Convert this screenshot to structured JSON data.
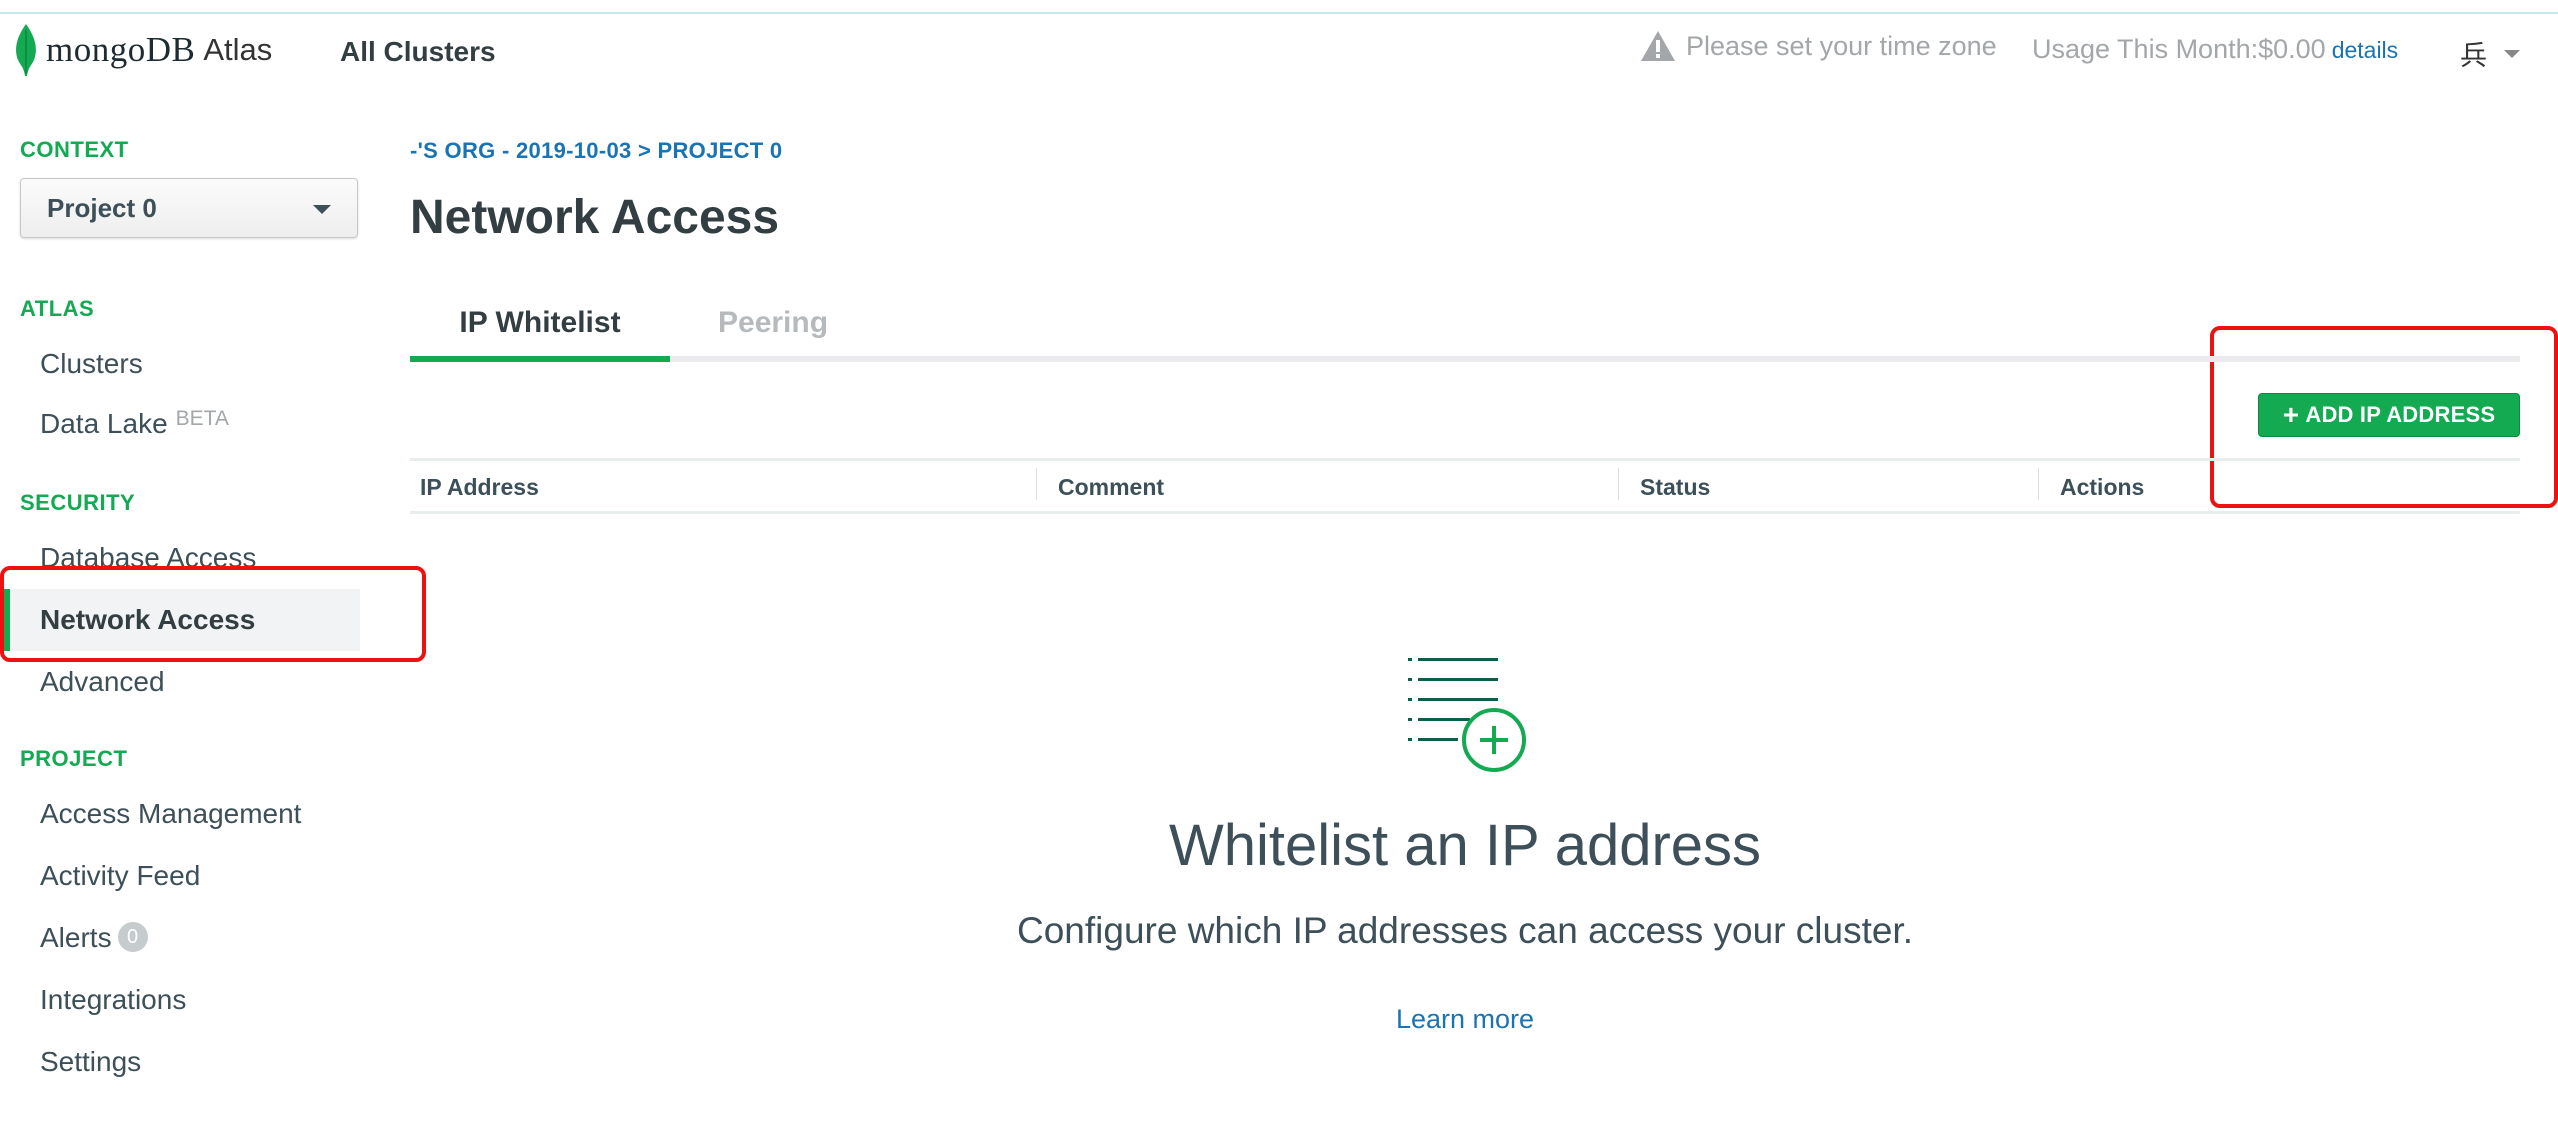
{
  "header": {
    "logo_mongo": "mongoDB",
    "logo_atlas": "Atlas",
    "all_clusters": "All Clusters",
    "timezone_warning": "Please set your time zone",
    "usage": "Usage This Month:$0.00",
    "usage_details": "details",
    "user_glyph": "兵"
  },
  "sidebar": {
    "context_heading": "CONTEXT",
    "context_value": "Project 0",
    "atlas_heading": "ATLAS",
    "clusters": "Clusters",
    "data_lake": "Data Lake",
    "data_lake_badge": "BETA",
    "security_heading": "SECURITY",
    "database_access": "Database Access",
    "network_access": "Network Access",
    "advanced": "Advanced",
    "project_heading": "PROJECT",
    "access_management": "Access Management",
    "activity_feed": "Activity Feed",
    "alerts": "Alerts",
    "alerts_count": "0",
    "integrations": "Integrations",
    "settings": "Settings"
  },
  "main": {
    "breadcrumb": "-'S ORG - 2019-10-03 > PROJECT 0",
    "title": "Network Access",
    "tabs": [
      {
        "label": "IP Whitelist",
        "active": true
      },
      {
        "label": "Peering",
        "active": false
      }
    ],
    "add_button": "ADD IP ADDRESS",
    "columns": [
      "IP Address",
      "Comment",
      "Status",
      "Actions"
    ],
    "empty_title": "Whitelist an IP address",
    "empty_subtitle": "Configure which IP addresses can access your cluster.",
    "learn_more": "Learn more"
  },
  "colors": {
    "accent_green": "#13aa52",
    "link_blue": "#1a74b4",
    "highlight_red": "#ee1111"
  }
}
